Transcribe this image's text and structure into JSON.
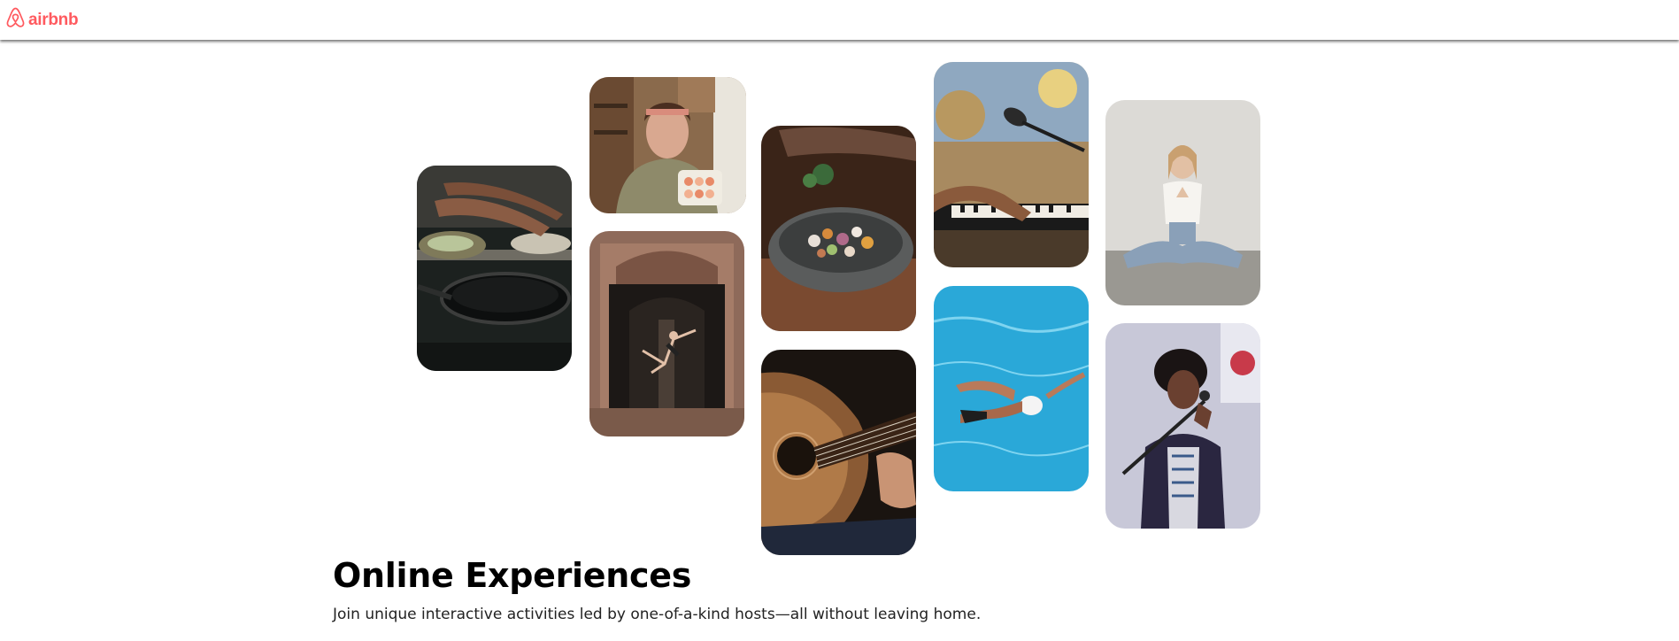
{
  "brand": {
    "name": "airbnb",
    "color": "#FF5A5F"
  },
  "hero": {
    "title": "Online Experiences",
    "subtitle": "Join unique interactive activities led by one-of-a-kind hosts—all without leaving home."
  },
  "photos": [
    {
      "name": "cooking-photo"
    },
    {
      "name": "baker-photo"
    },
    {
      "name": "dancer-photo"
    },
    {
      "name": "food-bowl-photo"
    },
    {
      "name": "guitar-photo"
    },
    {
      "name": "piano-microphone-photo"
    },
    {
      "name": "swimmer-photo"
    },
    {
      "name": "yoga-photo"
    },
    {
      "name": "singer-photo"
    }
  ]
}
